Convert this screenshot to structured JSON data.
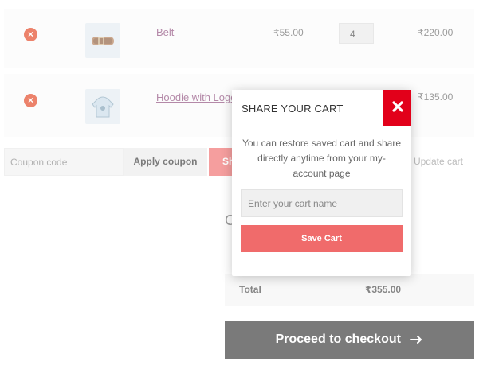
{
  "cart": {
    "items": [
      {
        "name": "Belt",
        "price": "₹55.00",
        "quantity": "4",
        "subtotal": "₹220.00",
        "thumb_icon": "belt-icon",
        "remove_icon": "remove-icon"
      },
      {
        "name": "Hoodie with Logo",
        "price": "",
        "quantity": "",
        "subtotal": "₹135.00",
        "thumb_icon": "hoodie-icon",
        "remove_icon": "remove-icon"
      }
    ],
    "coupon_placeholder": "Coupon code",
    "apply_coupon_label": "Apply coupon",
    "share_cart_label": "Sh",
    "update_cart_label": "Update cart"
  },
  "totals": {
    "heading_peek": "C",
    "total_label": "Total",
    "total_value": "₹355.00",
    "checkout_label": "Proceed to checkout",
    "checkout_icon": "arrow-right-icon"
  },
  "modal": {
    "title": "SHARE YOUR CART",
    "close_icon": "close-icon",
    "description": "You can restore saved cart and share directly anytime from your my-account page",
    "input_placeholder": "Enter your cart name",
    "save_label": "Save Cart"
  },
  "colors": {
    "remove": "#e2401c",
    "close": "#e2001a",
    "save": "#f06b6b",
    "checkout": "#333333",
    "link": "#8c4a7a"
  }
}
